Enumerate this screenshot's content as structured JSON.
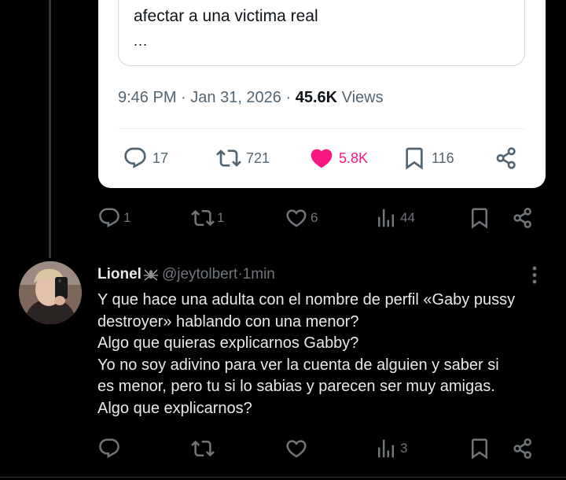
{
  "quoted_post": {
    "text_line": "afectar a una victima real",
    "ellipsis": "...",
    "time": "9:46 PM",
    "sep1": " · ",
    "date": "Jan 31, 2026",
    "sep2": " · ",
    "views_count": "45.6K",
    "views_label": " Views",
    "replies": "17",
    "reposts": "721",
    "likes": "5.8K",
    "bookmarks": "116"
  },
  "parent_actions": {
    "replies": "1",
    "reposts": "1",
    "likes": "6",
    "views": "44"
  },
  "reply": {
    "display_name": "Lionel",
    "handle": "@jeytolbert",
    "separator": " · ",
    "time": "1min",
    "lines": [
      "Y que hace una adulta con el nombre de perfil «Gaby pussy",
      "destroyer» hablando con una menor?",
      "Algo que quieras explicarnos Gabby?",
      "Yo no soy adivino para ver la cuenta de alguien y saber si",
      "es menor, pero tu si lo sabias y parecen ser muy amigas.",
      "Algo que explicarnos?"
    ],
    "views": "3"
  },
  "icons": {
    "reply": "reply-icon",
    "repost": "repost-icon",
    "like": "heart-icon",
    "views": "views-icon",
    "bookmark": "bookmark-icon",
    "share": "share-icon",
    "more": "more-icon",
    "badge": "spider-icon"
  },
  "colors": {
    "background": "#000000",
    "like_active": "#f91880",
    "muted": "#71767b",
    "text": "#e7e9ea"
  }
}
